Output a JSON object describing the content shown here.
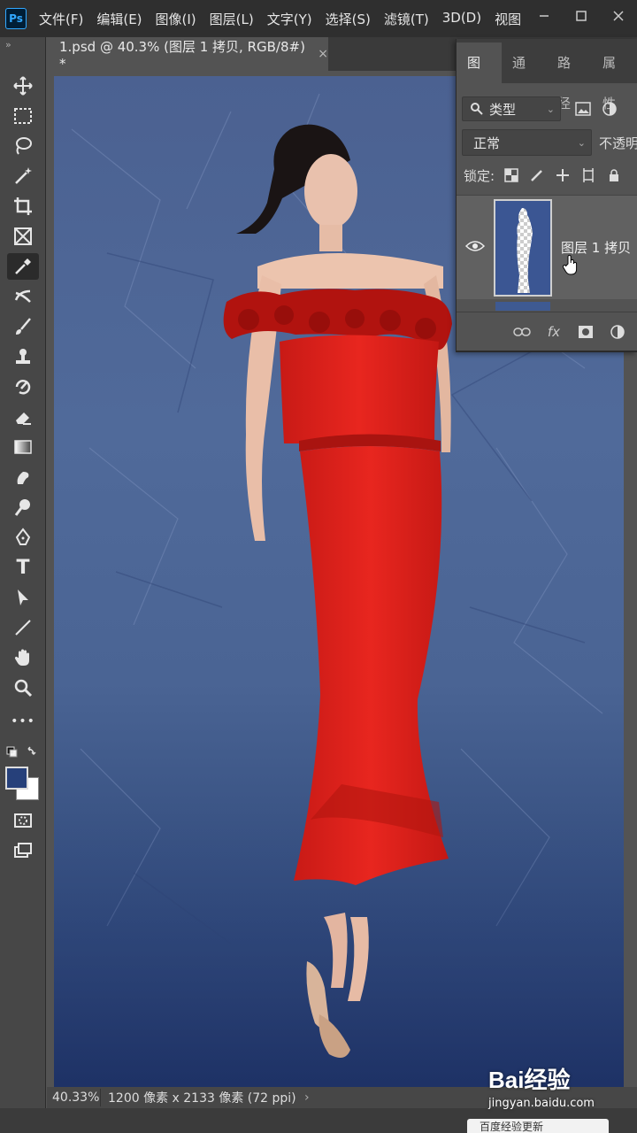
{
  "app": {
    "logo": "Ps",
    "menu": [
      "文件(F)",
      "编辑(E)",
      "图像(I)",
      "图层(L)",
      "文字(Y)",
      "选择(S)",
      "滤镜(T)",
      "3D(D)",
      "视图"
    ],
    "window_controls": [
      "minimize-icon",
      "restore-icon",
      "close-icon"
    ]
  },
  "toolbar": {
    "collapse": "»",
    "tools": [
      "move-icon",
      "marquee-icon",
      "lasso-icon",
      "magic-wand-icon",
      "crop-icon",
      "frame-icon",
      "eyedropper-icon",
      "healing-icon",
      "brush-icon",
      "stamp-icon",
      "history-brush-icon",
      "eraser-icon",
      "gradient-icon",
      "blur-icon",
      "dodge-icon",
      "pen-icon",
      "type-icon",
      "path-select-icon",
      "line-icon",
      "hand-icon",
      "zoom-icon",
      "more-icon"
    ],
    "type_tool_glyph": "T",
    "more_glyph": "•••",
    "foreground_color": "#26407a",
    "background_color": "#ffffff"
  },
  "document": {
    "tab_title": "1.psd @ 40.3% (图层 1 拷贝, RGB/8#) *",
    "tab_close": "×"
  },
  "status": {
    "zoom": "40.33%",
    "doc_size": "1200 像素 x 2133 像素 (72 ppi)",
    "arrow": "›"
  },
  "layers_panel": {
    "tabs": [
      "图层",
      "通道",
      "路径",
      "属性"
    ],
    "active_tab": "图层",
    "filter_kind": "类型",
    "blend_mode": "正常",
    "opacity_label": "不透明",
    "lock_label": "锁定:",
    "layers": [
      {
        "name": "图层 1 拷贝",
        "visible": true,
        "selected": true
      }
    ],
    "footer_icons": [
      "link-icon",
      "fx-icon",
      "mask-icon",
      "adjustment-icon"
    ],
    "fx_label": "fx"
  },
  "overlay": {
    "baidu_logo": "Bai经验",
    "baidu_url": "jingyan.baidu.com",
    "popup_text": "百度经验更新"
  },
  "colors": {
    "accent": "#31a8ff",
    "backdrop": "#4b6191",
    "dress": "#e0221e"
  }
}
